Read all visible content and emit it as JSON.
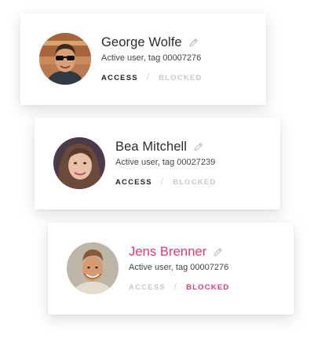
{
  "users": [
    {
      "name": "George Wolfe",
      "subtitle": "Active user, tag 00007276",
      "access_label": "ACCESS",
      "blocked_label": "BLOCKED",
      "state": "access",
      "edit_icon": "pencil-icon",
      "avatar_icon": "avatar-photo"
    },
    {
      "name": "Bea Mitchell",
      "subtitle": "Active user, tag 00027239",
      "access_label": "ACCESS",
      "blocked_label": "BLOCKED",
      "state": "access",
      "edit_icon": "pencil-icon",
      "avatar_icon": "avatar-photo"
    },
    {
      "name": "Jens Brenner",
      "subtitle": "Active user, tag 00007276",
      "access_label": "ACCESS",
      "blocked_label": "BLOCKED",
      "state": "blocked",
      "edit_icon": "pencil-icon",
      "avatar_icon": "avatar-photo"
    }
  ],
  "separator": "/",
  "colors": {
    "blocked_accent": "#e23a6a",
    "text_primary": "#2b2b2b",
    "muted": "#c8c8c8"
  }
}
